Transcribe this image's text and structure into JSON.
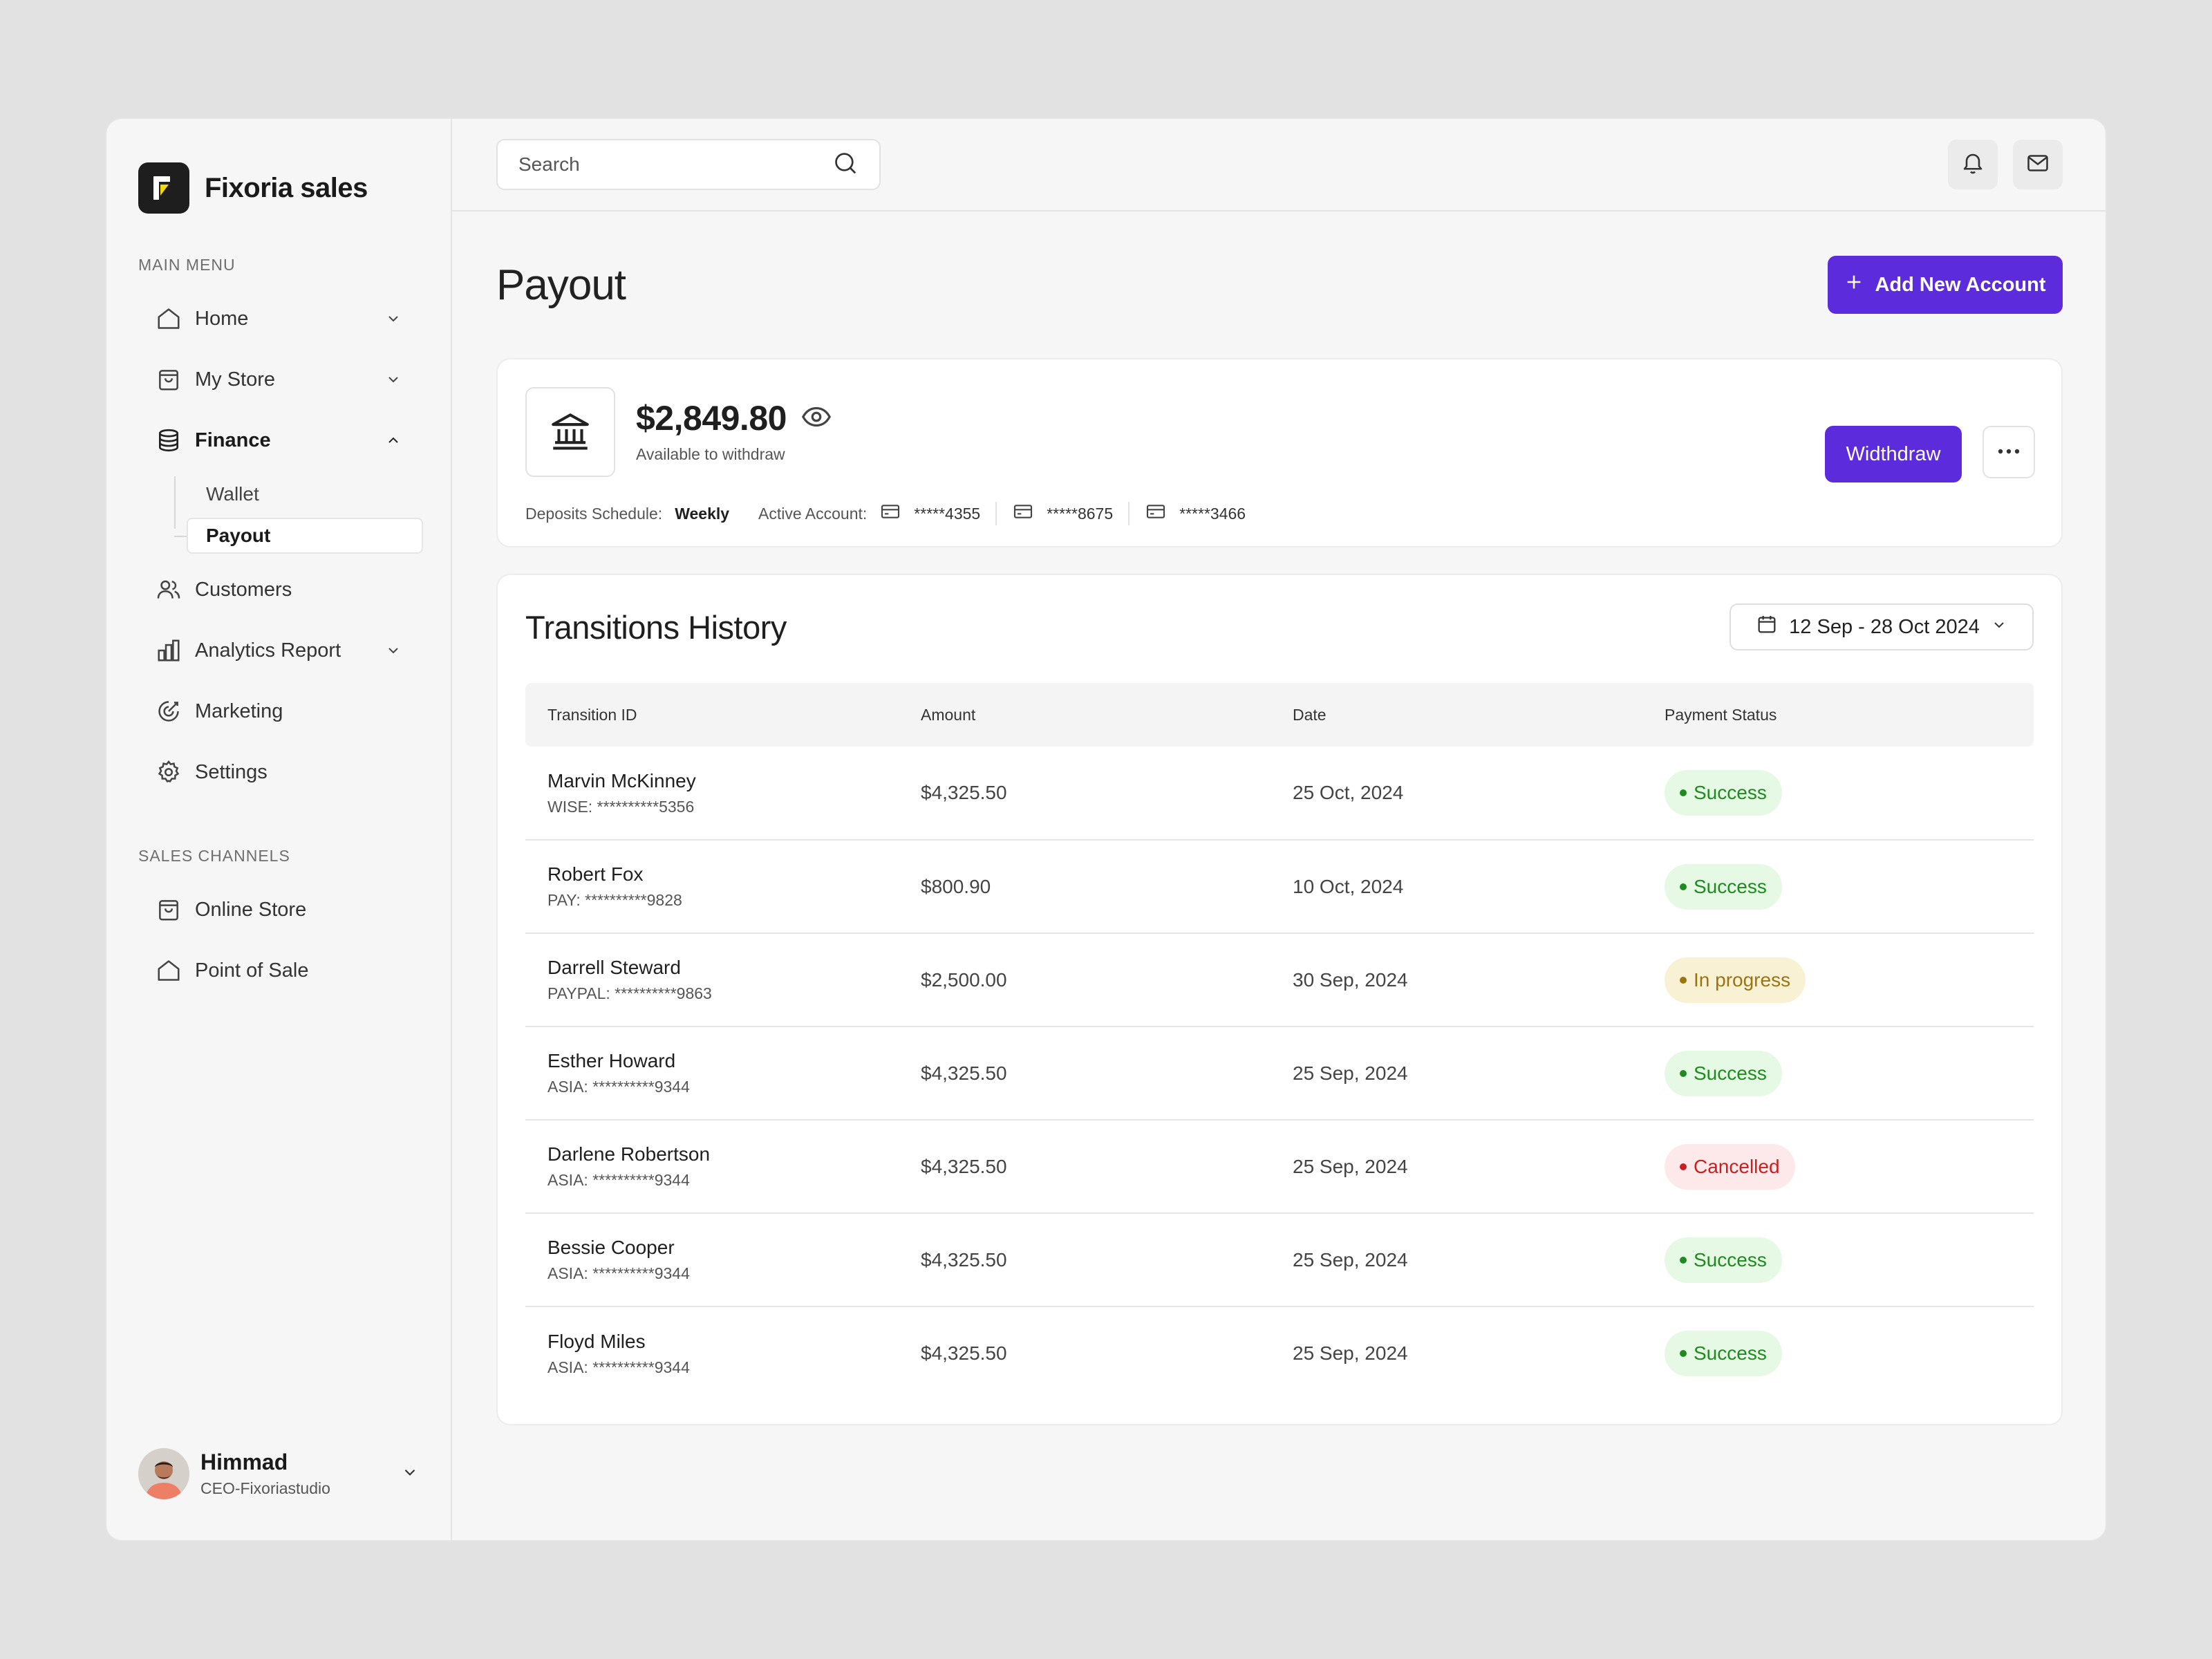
{
  "brand": {
    "name": "Fixoria sales"
  },
  "sidebar": {
    "main_menu_label": "MAIN MENU",
    "items": [
      {
        "label": "Home",
        "icon": "home-icon",
        "has_chevron": true,
        "expanded": false
      },
      {
        "label": "My Store",
        "icon": "store-bag-icon",
        "has_chevron": true,
        "expanded": false
      },
      {
        "label": "Finance",
        "icon": "database-icon",
        "has_chevron": true,
        "expanded": true,
        "children": [
          {
            "label": "Wallet",
            "active": false
          },
          {
            "label": "Payout",
            "active": true
          }
        ]
      },
      {
        "label": "Customers",
        "icon": "users-icon",
        "has_chevron": false
      },
      {
        "label": "Analytics Report",
        "icon": "bar-chart-icon",
        "has_chevron": true,
        "expanded": false
      },
      {
        "label": "Marketing",
        "icon": "target-icon",
        "has_chevron": false
      },
      {
        "label": "Settings",
        "icon": "gear-icon",
        "has_chevron": false
      }
    ],
    "sales_channels_label": "SALES CHANNELS",
    "channels": [
      {
        "label": "Online Store",
        "icon": "store-bag-icon"
      },
      {
        "label": "Point of Sale",
        "icon": "home-icon"
      }
    ],
    "user": {
      "name": "Himmad",
      "role": "CEO-Fixoriastudio"
    }
  },
  "topbar": {
    "search_placeholder": "Search"
  },
  "page": {
    "title": "Payout",
    "add_account_label": "Add New Account"
  },
  "payout": {
    "balance": "$2,849.80",
    "balance_caption": "Available to withdraw",
    "schedule_label": "Deposits Schedule:",
    "schedule_value": "Weekly",
    "active_account_label": "Active Account:",
    "accounts": [
      "*****4355",
      "*****8675",
      "*****3466"
    ],
    "withdraw_label": "Widthdraw"
  },
  "history": {
    "title": "Transitions History",
    "date_range": "12 Sep - 28 Oct 2024",
    "columns": [
      "Transition ID",
      "Amount",
      "Date",
      "Payment Status"
    ],
    "rows": [
      {
        "name": "Marvin McKinney",
        "account": "WISE: **********5356",
        "amount": "$4,325.50",
        "date": "25 Oct, 2024",
        "status": "Success"
      },
      {
        "name": "Robert Fox",
        "account": "PAY: **********9828",
        "amount": "$800.90",
        "date": "10 Oct, 2024",
        "status": "Success"
      },
      {
        "name": "Darrell Steward",
        "account": "PAYPAL: **********9863",
        "amount": "$2,500.00",
        "date": "30 Sep, 2024",
        "status": "In progress"
      },
      {
        "name": "Esther Howard",
        "account": "ASIA: **********9344",
        "amount": "$4,325.50",
        "date": "25 Sep, 2024",
        "status": "Success"
      },
      {
        "name": "Darlene Robertson",
        "account": "ASIA: **********9344",
        "amount": "$4,325.50",
        "date": "25 Sep, 2024",
        "status": "Cancelled"
      },
      {
        "name": "Bessie Cooper",
        "account": "ASIA: **********9344",
        "amount": "$4,325.50",
        "date": "25 Sep, 2024",
        "status": "Success"
      },
      {
        "name": "Floyd Miles",
        "account": "ASIA: **********9344",
        "amount": "$4,325.50",
        "date": "25 Sep, 2024",
        "status": "Success"
      }
    ]
  },
  "status_colors": {
    "Success": {
      "bg": "#e6f9e4",
      "fg": "#1f8a1f"
    },
    "In progress": {
      "bg": "#f8f1d4",
      "fg": "#9a7410"
    },
    "Cancelled": {
      "bg": "#fde9e9",
      "fg": "#c62020"
    }
  },
  "colors": {
    "accent": "#5b2bdc"
  }
}
